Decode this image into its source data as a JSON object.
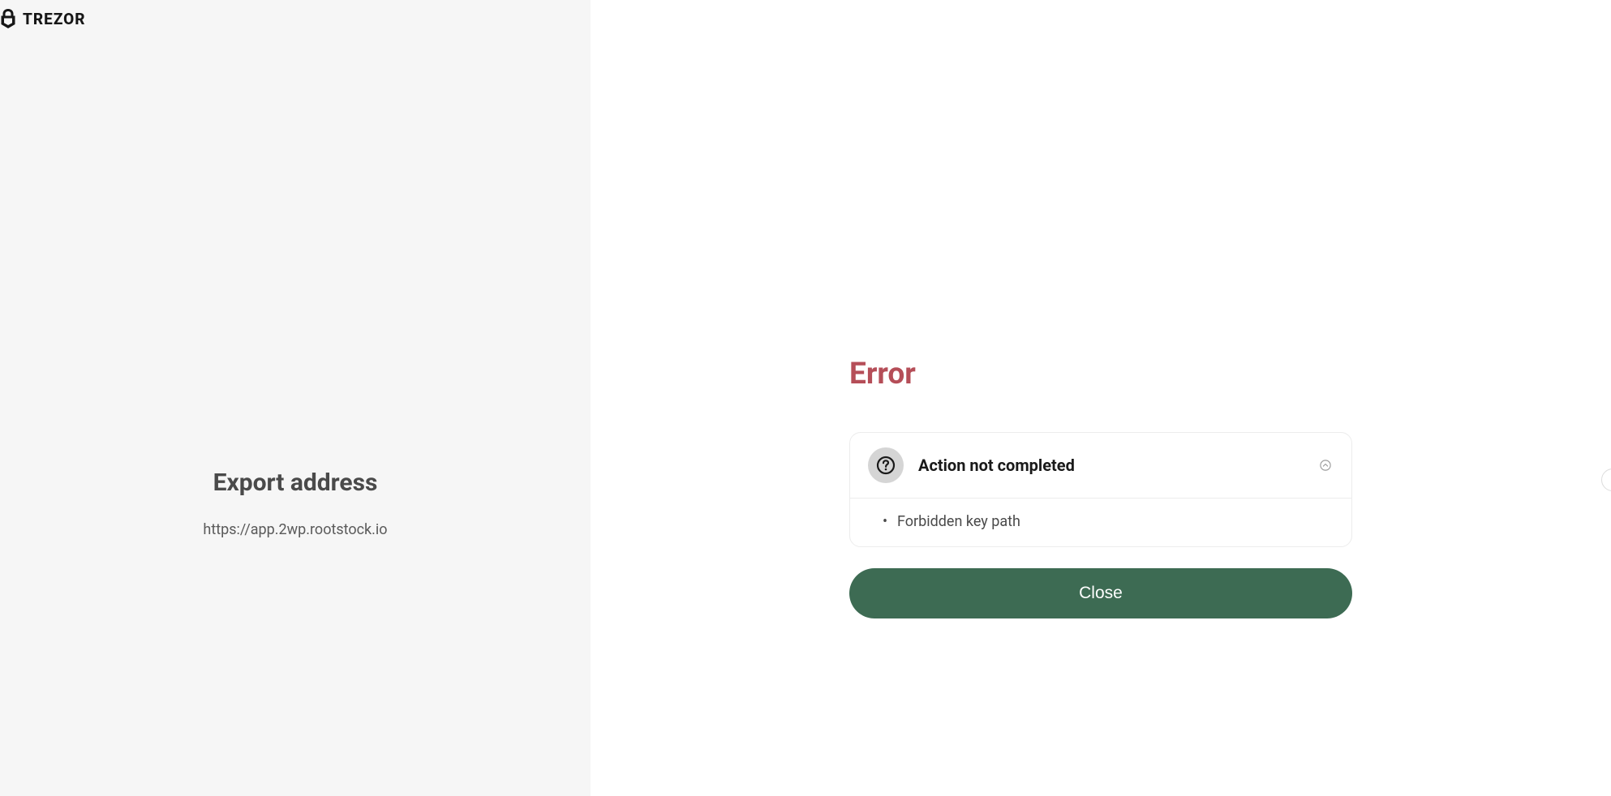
{
  "brand": {
    "name": "TREZOR"
  },
  "left": {
    "title": "Export address",
    "url": "https://app.2wp.rootstock.io"
  },
  "right": {
    "heading": "Error",
    "card": {
      "title": "Action not completed",
      "items": [
        "Forbidden key path"
      ]
    },
    "close_label": "Close"
  },
  "colors": {
    "error": "#b54e58",
    "accent": "#3d6b53",
    "left_bg": "#f6f6f6"
  }
}
